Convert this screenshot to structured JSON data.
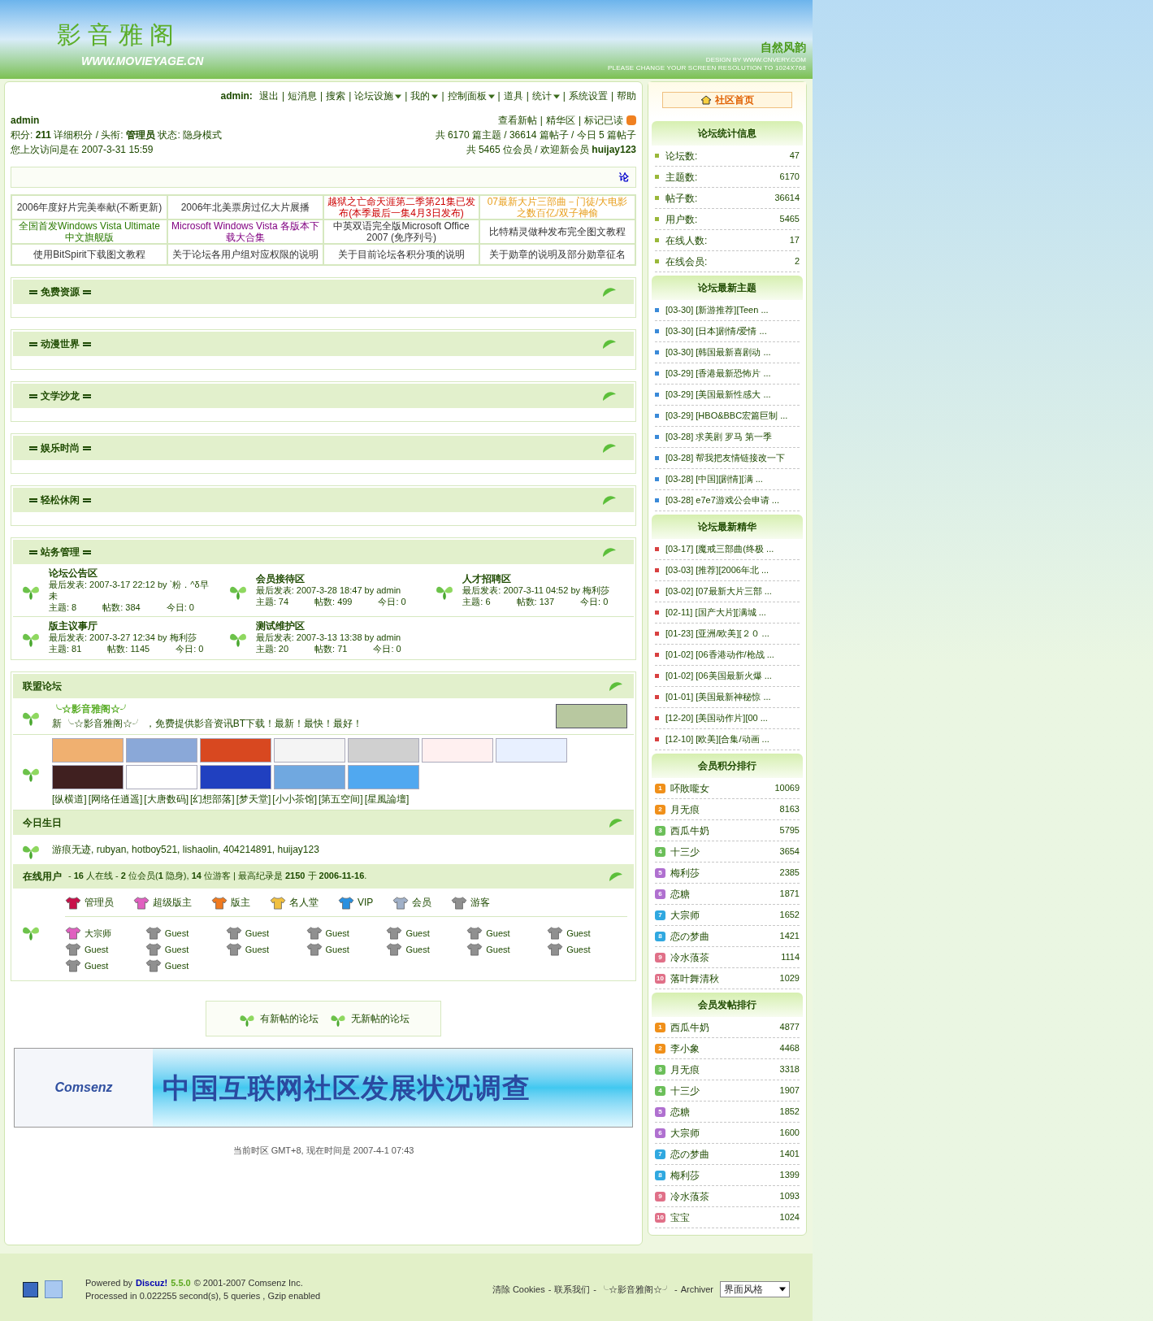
{
  "header": {
    "site_title": "影音雅阁",
    "site_url": "WWW.MOVIEYAGE.CN",
    "slogan": "自然风韵",
    "design_credit": "DESIGN BY WWW.CNVERY.COM",
    "resolution_note": "PLEASE CHANGE YOUR SCREEN RESOLUTION TO 1024X768"
  },
  "nav": {
    "user_label": "admin:",
    "separator": "|",
    "links": [
      {
        "label": "退出",
        "has_menu": false
      },
      {
        "label": "短消息",
        "has_menu": false
      },
      {
        "label": "搜索",
        "has_menu": false
      },
      {
        "label": "论坛设施",
        "has_menu": true
      },
      {
        "label": "我的",
        "has_menu": true
      },
      {
        "label": "控制面板",
        "has_menu": true
      },
      {
        "label": "道具",
        "has_menu": false
      },
      {
        "label": "统计",
        "has_menu": true
      },
      {
        "label": "系统设置",
        "has_menu": false
      },
      {
        "label": "帮助",
        "has_menu": false
      }
    ]
  },
  "user": {
    "name": "admin",
    "score_line": "积分: **211** 详细积分 / 头衔: **管理员** 状态: 隐身模式",
    "last_visit": "您上次访问是在 2007-3-31 15:59"
  },
  "board_stats": {
    "separator": "|",
    "links": [
      "查看新帖",
      "精华区",
      "标记已读"
    ],
    "lines": [
      "共 6170 篇主题 / 36614 篇帖子 / 今日 5 篇帖子",
      "共 5465 位会员 / 欢迎新会员 **huijay123**"
    ]
  },
  "announcement": "论",
  "top_links": [
    {
      "text": "2006年度好片完美奉献(不断更新)",
      "color": "#333333"
    },
    {
      "text": "2006年北美票房过亿大片展播",
      "color": "#333333"
    },
    {
      "text": "越狱之亡命天涯第二季第21集已发布(本季最后一集4月3日发布)",
      "color": "#cc0000"
    },
    {
      "text": "07最新大片三部曲－门徒/大电影之数百亿/双子神偷",
      "color": "#e8a020"
    },
    {
      "text": "全国首发Windows Vista Ultimate 中文旗舰版",
      "color": "#2a7a00"
    },
    {
      "text": "Microsoft Windows Vista 各版本下载大合集",
      "color": "#800080"
    },
    {
      "text": "中英双语完全版Microsoft Office 2007 (免序列号)",
      "color": "#333333"
    },
    {
      "text": "比特精灵做种发布完全图文教程",
      "color": "#333333"
    },
    {
      "text": "使用BitSpirit下载图文教程",
      "color": "#333333"
    },
    {
      "text": "关于论坛各用户组对应权限的说明",
      "color": "#333333"
    },
    {
      "text": "关于目前论坛各积分项的说明",
      "color": "#333333"
    },
    {
      "text": "关于勋章的说明及部分勋章征名",
      "color": "#333333"
    }
  ],
  "categories": [
    {
      "title": "免费资源"
    },
    {
      "title": "动漫世界"
    },
    {
      "title": "文学沙龙"
    },
    {
      "title": "娱乐时尚"
    },
    {
      "title": "轻松休闲"
    },
    {
      "title": "站务管理",
      "forums": [
        {
          "name": "论坛公告区",
          "last_post": "最后发表: 2007-3-17 22:12 by ˋ粉．^δ早未",
          "topics": "主题: 8",
          "posts": "帖数: 384",
          "today": "今日: 0"
        },
        {
          "name": "会员接待区",
          "last_post": "最后发表: 2007-3-28 18:47 by admin",
          "topics": "主题: 74",
          "posts": "帖数: 499",
          "today": "今日: 0"
        },
        {
          "name": "人才招聘区",
          "last_post": "最后发表: 2007-3-11 04:52 by 梅利莎",
          "topics": "主题: 6",
          "posts": "帖数: 137",
          "today": "今日: 0"
        },
        {
          "name": "版主议事厅",
          "last_post": "最后发表: 2007-3-27 12:34 by 梅利莎",
          "topics": "主题: 81",
          "posts": "帖数: 1145",
          "today": "今日: 0"
        },
        {
          "name": "测试维护区",
          "last_post": "最后发表: 2007-3-13 13:38 by admin",
          "topics": "主题: 20",
          "posts": "帖数: 71",
          "today": "今日: 0"
        }
      ]
    }
  ],
  "league": {
    "title": "联盟论坛",
    "featured_name": "╰☆影音雅阁☆╯",
    "featured_desc": "新 ╰☆影音雅阁☆╯ ，免费提供影音资讯BT下载！最新！最快！最好！",
    "text_links": [
      "[纵横道]",
      "[网络任逍遥]",
      "[大唐数码]",
      "[幻想部落]",
      "[梦天堂]",
      "[小小茶馆]",
      "[第五空间]",
      "[星風論壇]"
    ]
  },
  "birthdays": {
    "title": "今日生日",
    "names": "游痕无迹, rubyan, hotboy521, lishaolin, 404214891, huijay123"
  },
  "online": {
    "title": "在线用户",
    "summary": "- **16** 人在线 - **2** 位会员(**1** 隐身), **14** 位游客 | 最高纪录是 **2150** 于 **2006-11-16**.",
    "legend": [
      {
        "label": "管理员",
        "color": "#c8104a"
      },
      {
        "label": "超级版主",
        "color": "#e060c0"
      },
      {
        "label": "版主",
        "color": "#f07a20"
      },
      {
        "label": "名人堂",
        "color": "#f0c040"
      },
      {
        "label": "VIP",
        "color": "#2a90e0"
      },
      {
        "label": "会员",
        "color": "#a0b0c8"
      },
      {
        "label": "游客",
        "color": "#909090"
      }
    ],
    "users": [
      {
        "name": "大宗师",
        "color": "#e060c0"
      },
      {
        "name": "Guest",
        "color": "#909090"
      },
      {
        "name": "Guest",
        "color": "#909090"
      },
      {
        "name": "Guest",
        "color": "#909090"
      },
      {
        "name": "Guest",
        "color": "#909090"
      },
      {
        "name": "Guest",
        "color": "#909090"
      },
      {
        "name": "Guest",
        "color": "#909090"
      },
      {
        "name": "Guest",
        "color": "#909090"
      },
      {
        "name": "Guest",
        "color": "#909090"
      },
      {
        "name": "Guest",
        "color": "#909090"
      },
      {
        "name": "Guest",
        "color": "#909090"
      },
      {
        "name": "Guest",
        "color": "#909090"
      },
      {
        "name": "Guest",
        "color": "#909090"
      },
      {
        "name": "Guest",
        "color": "#909090"
      },
      {
        "name": "Guest",
        "color": "#909090"
      },
      {
        "name": "Guest",
        "color": "#909090"
      }
    ]
  },
  "legend_box": [
    "有新帖的论坛",
    "无新帖的论坛"
  ],
  "survey_banner": {
    "logo": "Comsenz",
    "headline": "中国互联网社区发展状况调查"
  },
  "time_line": "当前时区 GMT+8, 现在时间是 2007-4-1 07:43",
  "sidebar": {
    "home": "社区首页",
    "stats": {
      "title": "论坛统计信息",
      "rows": [
        {
          "label": "论坛数:",
          "value": "47"
        },
        {
          "label": "主题数:",
          "value": "6170"
        },
        {
          "label": "帖子数:",
          "value": "36614"
        },
        {
          "label": "用户数:",
          "value": "5465"
        },
        {
          "label": "在线人数:",
          "value": "17"
        },
        {
          "label": "在线会员:",
          "value": "2"
        }
      ]
    },
    "latest": {
      "title": "论坛最新主题",
      "items": [
        "[03-30] [新游推荐][Teen ...",
        "[03-30] [日本]剧情/爱情 ...",
        "[03-30] [韩国最新喜剧动 ...",
        "[03-29] [香港最新恐怖片 ...",
        "[03-29] [美国最新性感大 ...",
        "[03-29] [HBO&BBC宏篇巨制 ...",
        "[03-28] 求美剧 罗马 第一季",
        "[03-28] 帮我把友情链接改一下",
        "[03-28] [中国][剧情][满 ...",
        "[03-28] e7e7游戏公会申请 ..."
      ]
    },
    "digest": {
      "title": "论坛最新精华",
      "items": [
        "[03-17] [魔戒三部曲(终极 ...",
        "[03-03] [推荐][2006年北 ...",
        "[03-02] [07最新大片三部 ...",
        "[02-11] [国产大片][满城 ...",
        "[01-23] [亚洲/欧美][２０ ...",
        "[01-02] [06香港动作/枪战 ...",
        "[01-02] [06美国最新火爆 ...",
        "[01-01] [美国最新神秘惊 ...",
        "[12-20] [美国动作片][00 ...",
        "[12-10] [欧美][合集/动画 ..."
      ]
    },
    "credit_rank": {
      "title": "会员积分排行",
      "rows": [
        {
          "rank": "1",
          "name": "吥敗嚨女",
          "value": "10069",
          "color": "#f0901a"
        },
        {
          "rank": "2",
          "name": "月无痕",
          "value": "8163",
          "color": "#f0901a"
        },
        {
          "rank": "3",
          "name": "西瓜牛奶",
          "value": "5795",
          "color": "#6cbf5a"
        },
        {
          "rank": "4",
          "name": "十三少",
          "value": "3654",
          "color": "#6cbf5a"
        },
        {
          "rank": "5",
          "name": "梅利莎",
          "value": "2385",
          "color": "#b070d0"
        },
        {
          "rank": "6",
          "name": "恋糖",
          "value": "1871",
          "color": "#b070d0"
        },
        {
          "rank": "7",
          "name": "大宗师",
          "value": "1652",
          "color": "#30a8e0"
        },
        {
          "rank": "8",
          "name": "恋の梦曲",
          "value": "1421",
          "color": "#30a8e0"
        },
        {
          "rank": "9",
          "name": "冷水蒗茶",
          "value": "1114",
          "color": "#e07088"
        },
        {
          "rank": "10",
          "name": "落叶舞清秋",
          "value": "1029",
          "color": "#e07088"
        }
      ]
    },
    "post_rank": {
      "title": "会员发帖排行",
      "rows": [
        {
          "rank": "1",
          "name": "西瓜牛奶",
          "value": "4877",
          "color": "#f0901a"
        },
        {
          "rank": "2",
          "name": "李小象",
          "value": "4468",
          "color": "#f0901a"
        },
        {
          "rank": "3",
          "name": "月无痕",
          "value": "3318",
          "color": "#6cbf5a"
        },
        {
          "rank": "4",
          "name": "十三少",
          "value": "1907",
          "color": "#6cbf5a"
        },
        {
          "rank": "5",
          "name": "恋糖",
          "value": "1852",
          "color": "#b070d0"
        },
        {
          "rank": "6",
          "name": "大宗师",
          "value": "1600",
          "color": "#b070d0"
        },
        {
          "rank": "7",
          "name": "恋の梦曲",
          "value": "1401",
          "color": "#30a8e0"
        },
        {
          "rank": "8",
          "name": "梅利莎",
          "value": "1399",
          "color": "#30a8e0"
        },
        {
          "rank": "9",
          "name": "冷水蒗茶",
          "value": "1093",
          "color": "#e07088"
        },
        {
          "rank": "10",
          "name": "宝宝",
          "value": "1024",
          "color": "#e07088"
        }
      ]
    }
  },
  "footer": {
    "separator": "-",
    "powered_prefix": "Powered by",
    "product": "Discuz!",
    "version": "5.5.0",
    "copyright": "© 2001-2007 Comsenz Inc.",
    "processed": "Processed in 0.022255 second(s), 5 queries , Gzip enabled",
    "links": [
      "清除 Cookies",
      "联系我们",
      "╰☆影音雅阁☆╯",
      "Archiver"
    ],
    "style_select": "界面风格"
  }
}
